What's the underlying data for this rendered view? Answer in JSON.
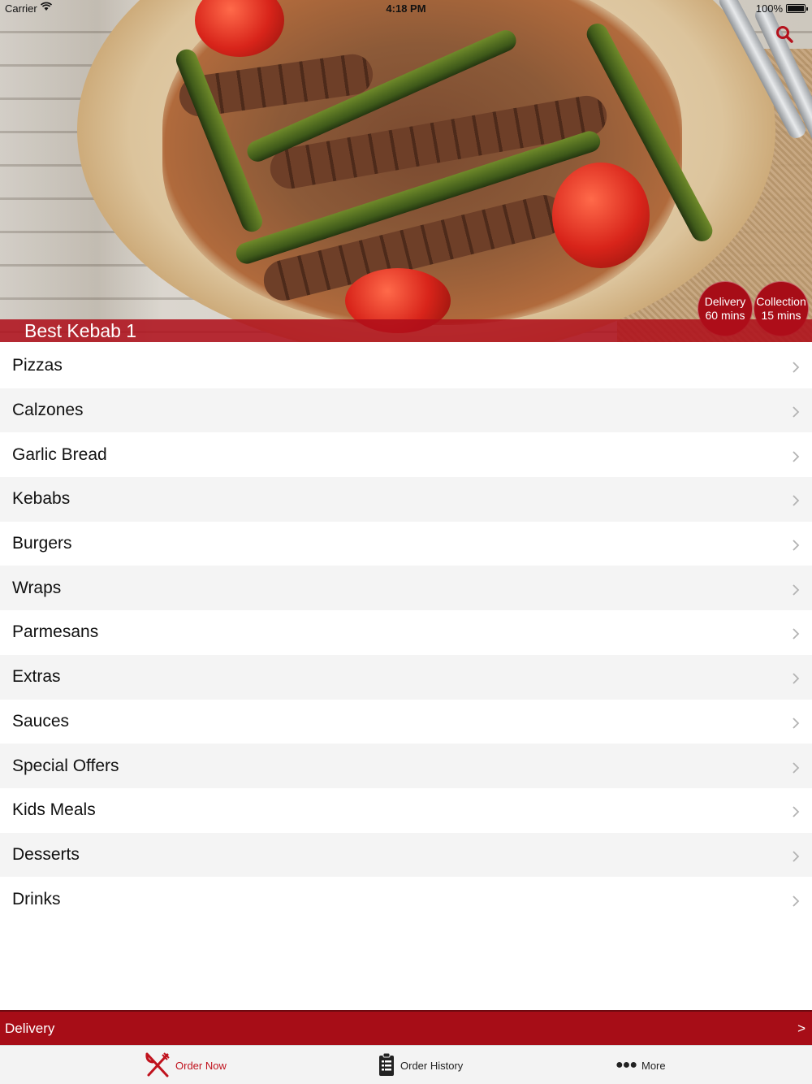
{
  "status_bar": {
    "carrier": "Carrier",
    "time": "4:18 PM",
    "battery": "100%"
  },
  "hero": {
    "restaurant_name": "Best Kebab 1",
    "delivery_badge": {
      "label": "Delivery",
      "time": "60 mins"
    },
    "collection_badge": {
      "label": "Collection",
      "time": "15 mins"
    }
  },
  "menu": {
    "items": [
      "Pizzas",
      "Calzones",
      "Garlic Bread",
      "Kebabs",
      "Burgers",
      "Wraps",
      "Parmesans",
      "Extras",
      "Sauces",
      "Special Offers",
      "Kids Meals",
      "Desserts",
      "Drinks"
    ]
  },
  "delivery_bar": {
    "label": "Delivery",
    "arrow": ">"
  },
  "tabs": {
    "order_now": "Order Now",
    "order_history": "Order History",
    "more": "More"
  },
  "colors": {
    "brand_red": "#a70d17",
    "active_tab": "#c0121d"
  },
  "icons": {
    "search": "search-icon",
    "order_now": "fork-knife-icon",
    "order_history": "clipboard-icon",
    "more": "ellipsis-icon",
    "chevron": "chevron-right-icon"
  }
}
